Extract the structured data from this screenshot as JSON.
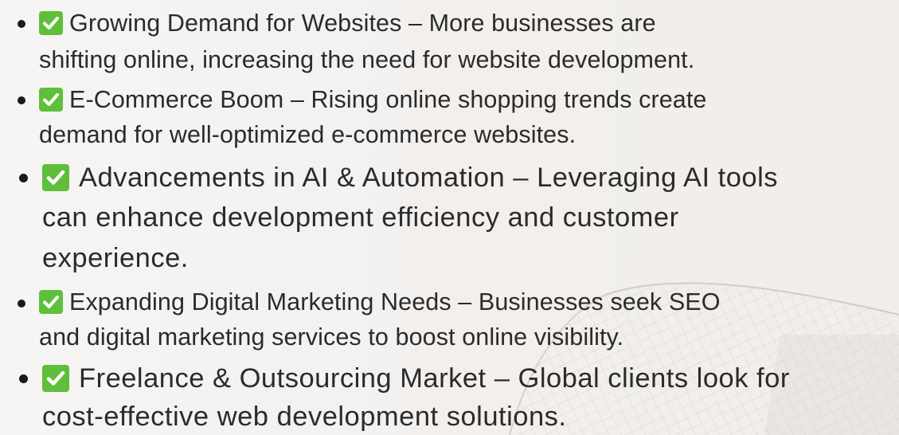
{
  "colors": {
    "background": "#f6f5f4",
    "text": "#2b2b2b",
    "check_badge": "#5fbf3a"
  },
  "items": [
    {
      "icon": "check-mark-icon",
      "line1": "Growing Demand for Websites – More businesses are",
      "line2": "shifting online, increasing the need for website development."
    },
    {
      "icon": "check-mark-icon",
      "line1": "E-Commerce Boom – Rising online shopping trends create",
      "line2": "demand for well-optimized e-commerce websites."
    },
    {
      "icon": "check-mark-icon",
      "line1": "Advancements in AI & Automation – Leveraging AI tools",
      "line2": "can enhance development efficiency and customer",
      "line3": "experience."
    },
    {
      "icon": "check-mark-icon",
      "line1": "Expanding Digital Marketing Needs – Businesses seek SEO",
      "line2": "and digital marketing services to boost online visibility."
    },
    {
      "icon": "check-mark-icon",
      "line1": "Freelance & Outsourcing Market – Global clients look for",
      "line2": "cost-effective web development solutions."
    }
  ]
}
